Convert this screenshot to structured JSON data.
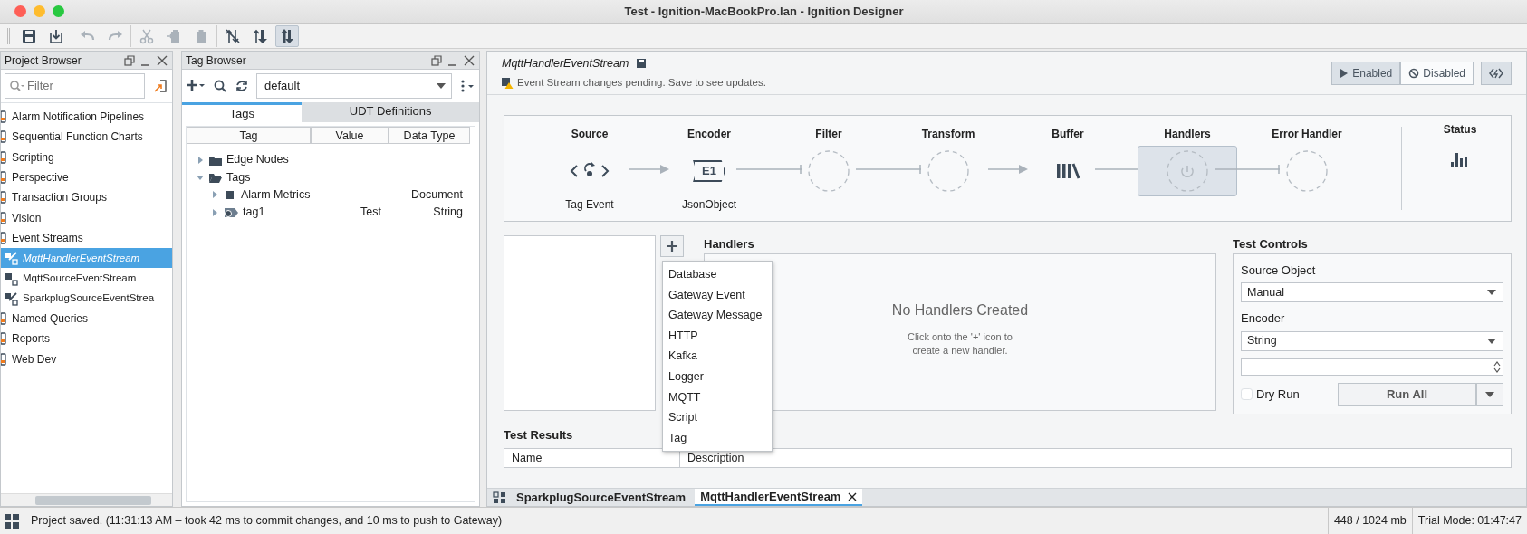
{
  "window": {
    "title": "Test - Ignition-MacBookPro.lan - Ignition Designer"
  },
  "toolbar": {
    "groups": [
      {
        "buttons": [
          {
            "kind": "save",
            "disabled": false,
            "selected": false
          },
          {
            "kind": "save-all",
            "disabled": false,
            "selected": false
          }
        ]
      },
      {
        "buttons": [
          {
            "kind": "undo",
            "disabled": true,
            "selected": false
          },
          {
            "kind": "redo",
            "disabled": true,
            "selected": false
          }
        ]
      },
      {
        "buttons": [
          {
            "kind": "cut",
            "disabled": true,
            "selected": false
          },
          {
            "kind": "copy",
            "disabled": true,
            "selected": false
          },
          {
            "kind": "paste",
            "disabled": true,
            "selected": false
          }
        ]
      },
      {
        "buttons": [
          {
            "kind": "sync-off",
            "disabled": false,
            "selected": false
          },
          {
            "kind": "sync",
            "disabled": false,
            "selected": false
          },
          {
            "kind": "sync-bold",
            "disabled": false,
            "selected": true
          }
        ]
      }
    ]
  },
  "project_browser": {
    "title": "Project Browser",
    "filter": {
      "placeholder": "Filter"
    },
    "items": [
      {
        "label": "Alarm Notification Pipelines",
        "selected": false
      },
      {
        "label": "Sequential Function Charts",
        "selected": false
      },
      {
        "label": "Scripting",
        "selected": false
      },
      {
        "label": "Perspective",
        "selected": false
      },
      {
        "label": "Transaction Groups",
        "selected": false
      },
      {
        "label": "Vision",
        "selected": false
      },
      {
        "label": "Event Streams",
        "selected": false,
        "children": [
          {
            "label": "MqttHandlerEventStream",
            "kind": "handler",
            "selected": true,
            "modified": true
          },
          {
            "label": "MqttSourceEventStream",
            "kind": "source",
            "selected": false,
            "modified": false
          },
          {
            "label": "SparkplugSourceEventStrea",
            "kind": "handler",
            "selected": false,
            "modified": false
          }
        ]
      },
      {
        "label": "Named Queries",
        "selected": false
      },
      {
        "label": "Reports",
        "selected": false
      },
      {
        "label": "Web Dev",
        "selected": false
      }
    ]
  },
  "tag_browser": {
    "title": "Tag Browser",
    "provider": "default",
    "tabs": [
      {
        "label": "Tags",
        "selected": true
      },
      {
        "label": "UDT Definitions",
        "selected": false
      }
    ],
    "columns": [
      "Tag",
      "Value",
      "Data Type"
    ],
    "rows": [
      {
        "name": "Edge Nodes",
        "kind": "folder",
        "expanded": false
      },
      {
        "name": "Tags",
        "kind": "folder",
        "expanded": true,
        "children": [
          {
            "name": "Alarm Metrics",
            "kind": "udt",
            "expanded": false,
            "data_type": "Document"
          },
          {
            "name": "tag1",
            "kind": "tag",
            "expanded": false,
            "value": "Test",
            "data_type": "String"
          }
        ]
      }
    ]
  },
  "editor": {
    "title": "MqttHandlerEventStream",
    "notice": "Event Stream changes pending. Save to see updates.",
    "modes": [
      {
        "label": "Enabled",
        "kind": "play",
        "selected": true
      },
      {
        "label": "Disabled",
        "kind": "ban",
        "selected": false
      }
    ],
    "stages": [
      {
        "label": "Source",
        "kind": "source",
        "caption": "Tag Event",
        "selected": false
      },
      {
        "label": "Encoder",
        "kind": "encoder",
        "icon_text": "E1",
        "caption": "JsonObject",
        "selected": false
      },
      {
        "label": "Filter",
        "kind": "empty",
        "selected": false
      },
      {
        "label": "Transform",
        "kind": "empty",
        "selected": false
      },
      {
        "label": "Buffer",
        "kind": "buffer",
        "selected": false
      },
      {
        "label": "Handlers",
        "kind": "empty",
        "selected": true
      },
      {
        "label": "Error Handler",
        "kind": "empty",
        "selected": false
      }
    ],
    "status": {
      "label": "Status"
    },
    "handlers": {
      "title": "Handlers",
      "empty_title": "No Handlers Created",
      "empty_hint": "Click onto the '+' icon to create a new handler.",
      "add_menu": {
        "open": true,
        "items": [
          "Database",
          "Gateway Event",
          "Gateway Message",
          "HTTP",
          "Kafka",
          "Logger",
          "MQTT",
          "Script",
          "Tag"
        ]
      }
    },
    "test_controls": {
      "title": "Test Controls",
      "source_object": {
        "label": "Source Object",
        "value": "Manual"
      },
      "encoder": {
        "label": "Encoder",
        "value": "String"
      },
      "dry_run": {
        "label": "Dry Run",
        "checked": false
      },
      "run_button": "Run All"
    },
    "test_results": {
      "title": "Test Results",
      "columns": [
        "Name",
        "Description"
      ]
    },
    "tabs": [
      {
        "label": "SparkplugSourceEventStream",
        "selected": false,
        "closable": false
      },
      {
        "label": "MqttHandlerEventStream",
        "selected": true,
        "closable": true
      }
    ]
  },
  "status_bar": {
    "message": "Project saved. (11:31:13 AM – took 42 ms to commit changes, and 10 ms to push to Gateway)",
    "memory": "448 / 1024 mb",
    "trial": "Trial Mode: 01:47:47"
  }
}
